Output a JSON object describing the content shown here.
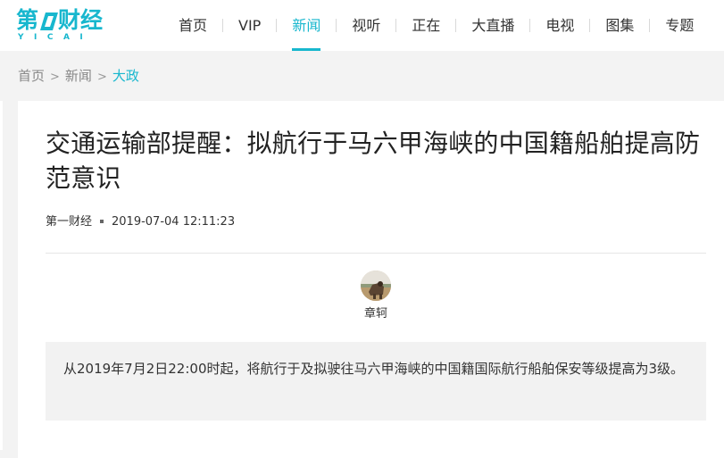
{
  "brand": {
    "logo_text": "第一财经",
    "logo_main_visible": "第 财经",
    "logo_sub": "YICAI",
    "accent_color": "#18b7ce"
  },
  "nav": {
    "items": [
      {
        "label": "首页",
        "active": false
      },
      {
        "label": "VIP",
        "active": false
      },
      {
        "label": "新闻",
        "active": true
      },
      {
        "label": "视听",
        "active": false
      },
      {
        "label": "正在",
        "active": false
      },
      {
        "label": "大直播",
        "active": false
      },
      {
        "label": "电视",
        "active": false
      },
      {
        "label": "图集",
        "active": false
      },
      {
        "label": "专题",
        "active": false
      }
    ]
  },
  "breadcrumb": {
    "items": [
      "首页",
      "新闻",
      "大政"
    ],
    "separator": ">"
  },
  "article": {
    "title": "交通运输部提醒：拟航行于马六甲海峡的中国籍船舶提高防范意识",
    "source": "第一财经",
    "datetime": "2019-07-04 12:11:23",
    "author": "章轲",
    "avatar_icon": "author-photo-icon",
    "summary": "从2019年7月2日22:00时起，将航行于及拟驶往马六甲海峡的中国籍国际航行船舶保安等级提高为3级。"
  }
}
